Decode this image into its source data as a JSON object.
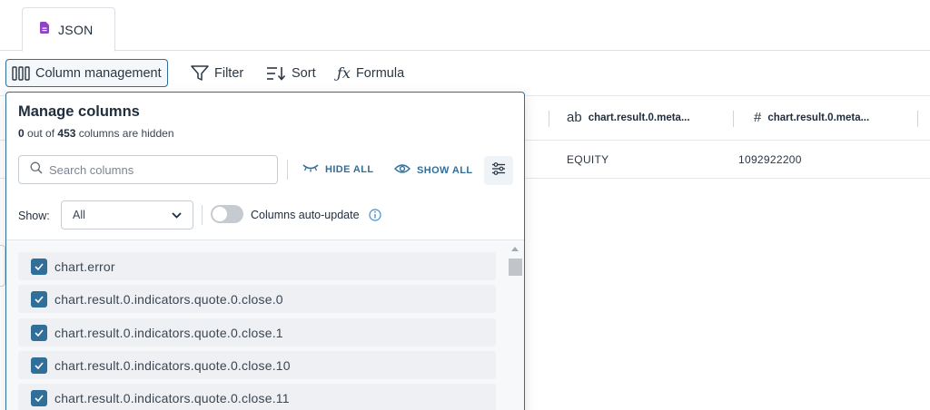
{
  "tabs": [
    {
      "label": "JSON",
      "icon": "json-file-icon",
      "color": "#8e44c9"
    }
  ],
  "toolbar": {
    "column_management": "Column management",
    "filter": "Filter",
    "sort": "Sort",
    "formula": "Formula"
  },
  "grid": {
    "columns": [
      {
        "type": "ab",
        "name": "chart.result.0.meta..."
      },
      {
        "type": "#",
        "name": "chart.result.0.meta..."
      }
    ],
    "row": [
      "EQUITY",
      "1092922200"
    ]
  },
  "popover": {
    "title": "Manage columns",
    "hidden_count": "0",
    "hidden_text_mid": " out of ",
    "total_count": "453",
    "hidden_text_end": " columns are hidden",
    "search_placeholder": "Search columns",
    "hide_all": "HIDE ALL",
    "show_all": "SHOW ALL",
    "show_label": "Show:",
    "show_value": "All",
    "auto_update_label": "Columns auto-update",
    "items": [
      {
        "label": "chart.error",
        "checked": true
      },
      {
        "label": "chart.result.0.indicators.quote.0.close.0",
        "checked": true
      },
      {
        "label": "chart.result.0.indicators.quote.0.close.1",
        "checked": true
      },
      {
        "label": "chart.result.0.indicators.quote.0.close.10",
        "checked": true
      },
      {
        "label": "chart.result.0.indicators.quote.0.close.11",
        "checked": true
      }
    ]
  },
  "colors": {
    "accent": "#2f6f9a",
    "border": "#dcdfe4"
  }
}
